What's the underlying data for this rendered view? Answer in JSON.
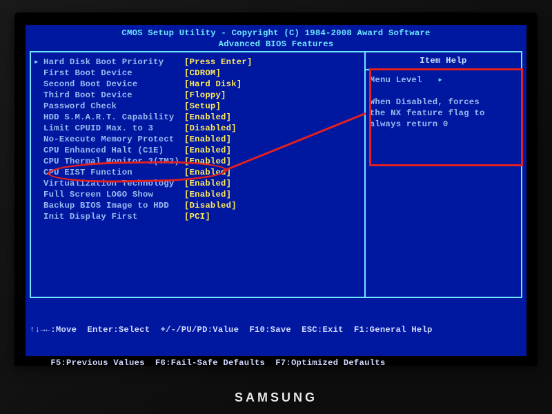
{
  "header": {
    "line1": "CMOS Setup Utility - Copyright (C) 1984-2008 Award Software",
    "line2": "Advanced BIOS Features"
  },
  "settings": [
    {
      "cursor": true,
      "label": "Hard Disk Boot Priority",
      "value": "[Press Enter]",
      "value_yellow": true
    },
    {
      "cursor": false,
      "label": "First Boot Device",
      "value": "[CDROM]",
      "value_yellow": true
    },
    {
      "cursor": false,
      "label": "Second Boot Device",
      "value": "[Hard Disk]",
      "value_yellow": true
    },
    {
      "cursor": false,
      "label": "Third Boot Device",
      "value": "[Floppy]",
      "value_yellow": true
    },
    {
      "cursor": false,
      "label": "Password Check",
      "value": "[Setup]",
      "value_yellow": true
    },
    {
      "cursor": false,
      "label": "HDD S.M.A.R.T. Capability",
      "value": "[Enabled]",
      "value_yellow": true
    },
    {
      "cursor": false,
      "label": "Limit CPUID Max. to 3",
      "value": "[Disabled]",
      "value_yellow": true
    },
    {
      "cursor": false,
      "label": "No-Execute Memory Protect",
      "value": "[Enabled]",
      "value_yellow": true
    },
    {
      "cursor": false,
      "label": "CPU Enhanced Halt (C1E)",
      "value": "[Enabled]",
      "value_yellow": true
    },
    {
      "cursor": false,
      "label": "CPU Thermal Monitor 2(TM2)",
      "value": "[Enabled]",
      "value_yellow": true
    },
    {
      "cursor": false,
      "label": "CPU EIST Function",
      "value": "[Enabled]",
      "value_yellow": true
    },
    {
      "cursor": false,
      "label": "Virtualization Technology",
      "value": "[Enabled]",
      "value_yellow": true
    },
    {
      "cursor": false,
      "label": "Full Screen LOGO Show",
      "value": "[Enabled]",
      "value_yellow": true
    },
    {
      "cursor": false,
      "label": "Backup BIOS Image to HDD",
      "value": "[Disabled]",
      "value_yellow": true
    },
    {
      "cursor": false,
      "label": "Init Display First",
      "value": "[PCI]",
      "value_yellow": true
    }
  ],
  "help": {
    "title": "Item Help",
    "menu_level": "Menu Level",
    "body1": "When Disabled, forces",
    "body2": "the NX feature flag to",
    "body3": "always return 0"
  },
  "footer": {
    "line1": "↑↓→←:Move  Enter:Select  +/-/PU/PD:Value  F10:Save  ESC:Exit  F1:General Help",
    "line2": "    F5:Previous Values  F6:Fail-Safe Defaults  F7:Optimized Defaults"
  },
  "monitor_brand": "SAMSUNG"
}
